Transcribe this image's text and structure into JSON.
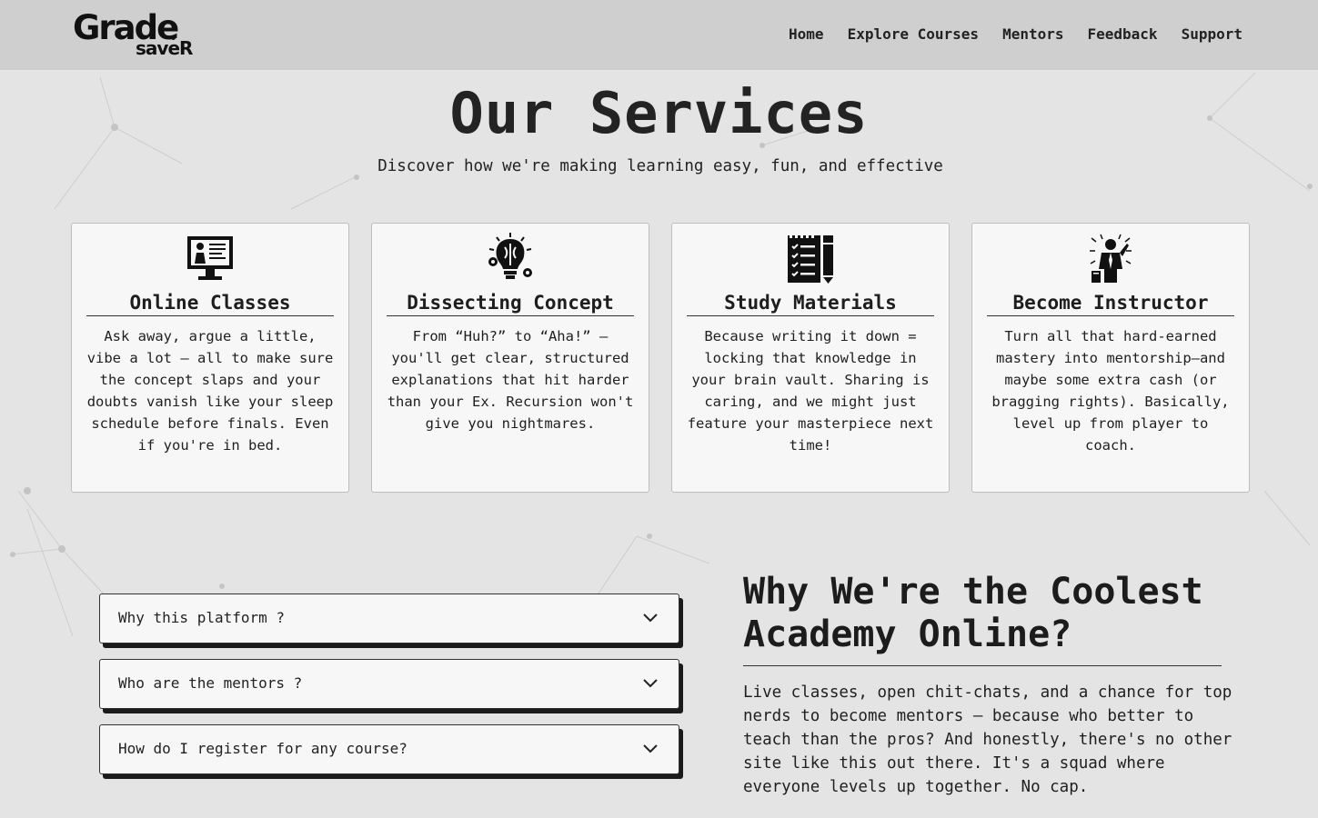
{
  "brand": {
    "logo_top": "Grade",
    "logo_bottom": "saveR"
  },
  "nav": [
    {
      "label": "Home"
    },
    {
      "label": "Explore Courses"
    },
    {
      "label": "Mentors"
    },
    {
      "label": "Feedback"
    },
    {
      "label": "Support"
    }
  ],
  "services": {
    "title": "Our Services",
    "subtitle": "Discover how we're making learning easy, fun, and effective",
    "cards": [
      {
        "icon": "online-classes-icon",
        "title": "Online Classes",
        "text": "Ask away, argue a little, vibe a lot — all to make sure the concept slaps and your doubts vanish like your sleep schedule before finals. Even if you're in bed."
      },
      {
        "icon": "dissecting-concept-icon",
        "title": "Dissecting Concept",
        "text": "From “Huh?” to “Aha!” — you'll get clear, structured explanations that hit harder than your Ex. Recursion won't give you nightmares."
      },
      {
        "icon": "study-materials-icon",
        "title": "Study Materials",
        "text": "Because writing it down = locking that knowledge in your brain vault. Sharing is caring, and we might just feature your masterpiece next time!"
      },
      {
        "icon": "become-instructor-icon",
        "title": "Become Instructor",
        "text": "Turn all that hard-earned mastery into mentorship—and maybe some extra cash (or bragging rights). Basically, level up from player to coach."
      }
    ]
  },
  "faq": [
    {
      "question": "Why this platform ?"
    },
    {
      "question": "Who are the mentors ?"
    },
    {
      "question": "How do I register for any course?"
    }
  ],
  "why": {
    "title": "Why We're the Coolest Academy Online?",
    "text": "Live classes, open chit-chats, and a chance for top nerds to become mentors — because who better to teach than the pros? And honestly, there's no other site like this out there. It's a squad where everyone levels up together. No cap."
  }
}
